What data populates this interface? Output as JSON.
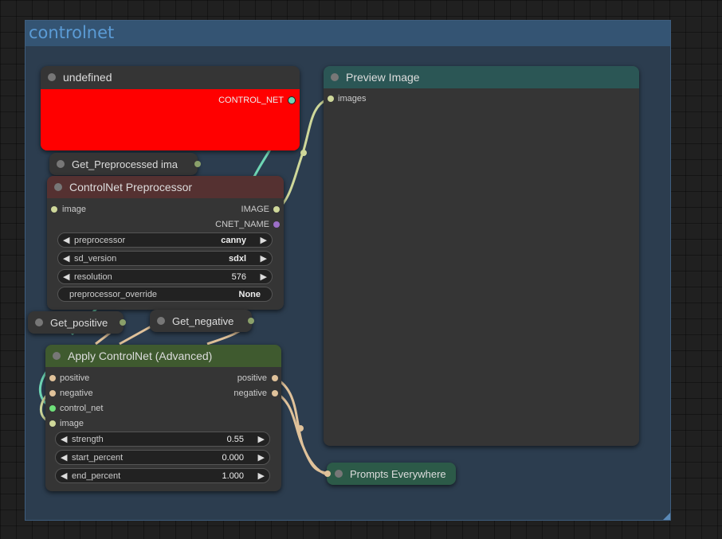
{
  "group": {
    "title": "controlnet"
  },
  "undefined_node": {
    "title": "undefined",
    "output": "CONTROL_NET"
  },
  "get_preprocessed": {
    "title": "Get_Preprocessed ima"
  },
  "preprocessor_node": {
    "title": "ControlNet Preprocessor",
    "input": "image",
    "outputs": [
      "IMAGE",
      "CNET_NAME"
    ],
    "widgets": [
      {
        "name": "preprocessor",
        "value": "canny"
      },
      {
        "name": "sd_version",
        "value": "sdxl"
      },
      {
        "name": "resolution",
        "value": "576"
      }
    ],
    "override": {
      "name": "preprocessor_override",
      "value": "None"
    }
  },
  "get_positive": {
    "title": "Get_positive"
  },
  "get_negative": {
    "title": "Get_negative"
  },
  "apply_node": {
    "title": "Apply ControlNet (Advanced)",
    "inputs": [
      "positive",
      "negative",
      "control_net",
      "image"
    ],
    "outputs": [
      "positive",
      "negative"
    ],
    "widgets": [
      {
        "name": "strength",
        "value": "0.55"
      },
      {
        "name": "start_percent",
        "value": "0.000"
      },
      {
        "name": "end_percent",
        "value": "1.000"
      }
    ]
  },
  "preview_node": {
    "title": "Preview Image",
    "input": "images"
  },
  "prompts_node": {
    "title": "Prompts Everywhere"
  },
  "arrows": {
    "left": "◀",
    "right": "▶"
  },
  "colors": {
    "control_net": "#00d78d",
    "image": "#64b5f6",
    "conditioning": "#ffa931",
    "wire_image": "#cfd89a",
    "wire_control": "#6fd6b4",
    "wire_cond": "#e0c29a",
    "undefined_body": "#ff0000",
    "preview_title": "#2b5655",
    "prompts_title": "#2c5a48",
    "preprocessor_title": "#553131",
    "apply_title": "#3f5a2f"
  }
}
